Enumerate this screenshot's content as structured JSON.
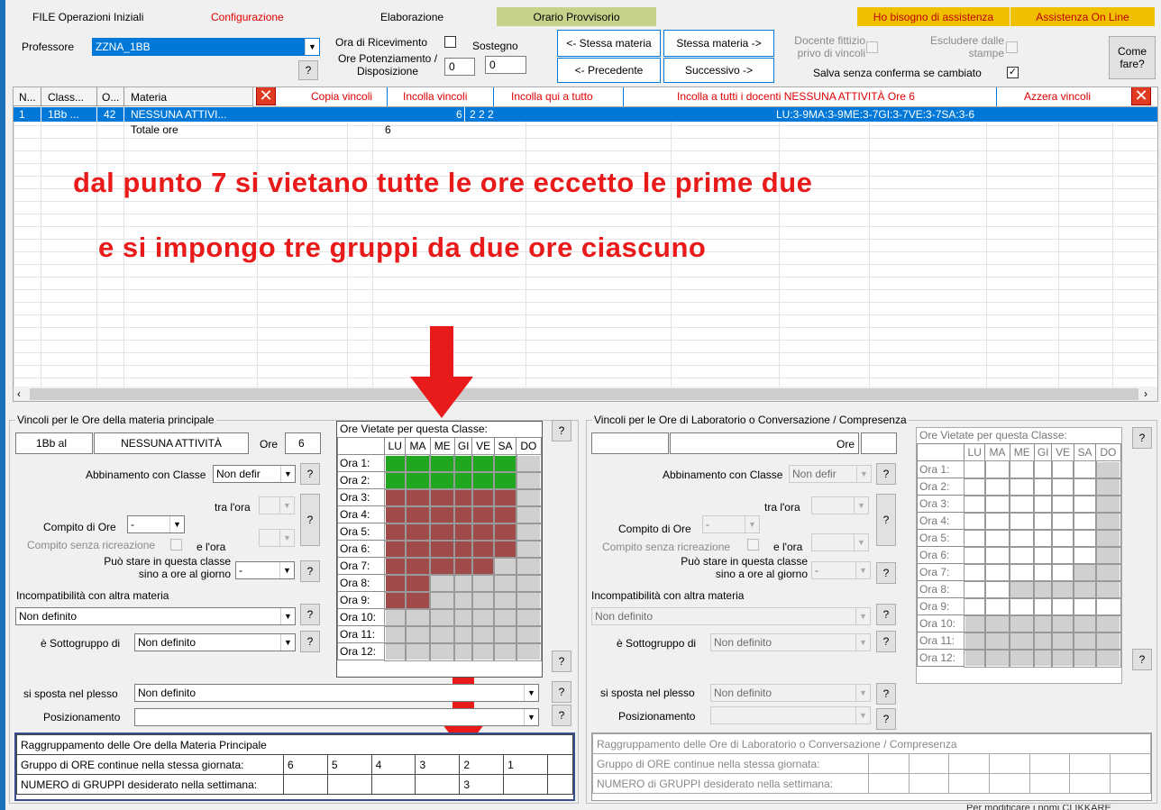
{
  "menu": {
    "file": "FILE Operazioni Iniziali",
    "config": "Configurazione",
    "elab": "Elaborazione",
    "orario": "Orario Provvisorio",
    "help": "Ho bisogno di assistenza",
    "online": "Assistenza On Line"
  },
  "top": {
    "prof_label": "Professore",
    "prof_value": "ZZNA_1BB",
    "ora_ric": "Ora di Ricevimento",
    "sostegno": "Sostegno",
    "ore_pot": "Ore Potenziamento / Disposizione",
    "pot_val": "0",
    "sost_val": "0",
    "q": "?",
    "stessa_prev": "<- Stessa materia",
    "stessa_next": "Stessa materia ->",
    "precedente": "<- Precedente",
    "successivo": "Successivo ->",
    "fittizio": "Docente fittizio privo di vincoli",
    "escludere": "Escludere dalle stampe",
    "salva": "Salva senza conferma se cambiato",
    "come": "Come fare?"
  },
  "grid": {
    "cols": [
      "N...",
      "Class...",
      "O...",
      "Materia"
    ],
    "actions": [
      "Copia vincoli",
      "Incolla vincoli",
      "Incolla qui a tutto",
      "Incolla a tutti i docenti NESSUNA ATTIVITÀ Ore 6",
      "Azzera vincoli"
    ],
    "row": {
      "n": "1",
      "classe": "1Bb ...",
      "o": "42",
      "materia": "NESSUNA ATTIVI...",
      "ore": "6",
      "gruppi": "2 2 2",
      "vincoli": "LU:3-9MA:3-9ME:3-7GI:3-7VE:3-7SA:3-6"
    },
    "total_label": "Totale ore",
    "total_val": "6"
  },
  "annotation": {
    "line1": "dal punto 7 si vietano tutte le ore eccetto le prime due",
    "line2": "e si impongo tre gruppi da due ore ciascuno"
  },
  "left": {
    "title": "Vincoli per le Ore della materia principale",
    "classe": "1Bb al",
    "materia": "NESSUNA ATTIVITÀ",
    "ore_label": "Ore",
    "ore_val": "6",
    "abbinamento": "Abbinamento con Classe",
    "abb_val": "Non defir",
    "tra_ora": "tra l'ora",
    "compito": "Compito di Ore",
    "compito_val": "-",
    "senza_ric": "Compito senza ricreazione",
    "e_ora": "e l'ora",
    "puo_stare": "Può stare in questa classe sino a ore al giorno",
    "puo_val": "-",
    "incomp": "Incompatibilità con altra materia",
    "incomp_val": "Non definito",
    "sottogruppo": "è Sottogruppo di",
    "sotto_val": "Non definito",
    "plesso": "si sposta nel plesso",
    "plesso_val": "Non definito",
    "posiz": "Posizionamento",
    "posiz_val": "",
    "ragg_title": "Raggruppamento delle Ore della Materia Principale",
    "gruppo_label": "Gruppo di ORE continue nella stessa giornata:",
    "gruppo_vals": [
      "6",
      "5",
      "4",
      "3",
      "2",
      "1",
      ""
    ],
    "numero_label": "NUMERO di GRUPPI desiderato nella settimana:",
    "numero_vals": [
      "",
      "",
      "",
      "",
      "3",
      "",
      ""
    ]
  },
  "right": {
    "title": "Vincoli per le Ore di Laboratorio o Conversazione / Compresenza",
    "ore_label": "Ore",
    "abbinamento": "Abbinamento con Classe",
    "abb_val": "Non defir",
    "tra_ora": "tra l'ora",
    "compito": "Compito di Ore",
    "compito_val": "-",
    "senza_ric": "Compito senza ricreazione",
    "e_ora": "e l'ora",
    "puo_stare": "Può stare in questa classe sino a ore al giorno",
    "puo_val": "-",
    "incomp": "Incompatibilità con altra materia",
    "incomp_val": "Non definito",
    "sottogruppo": "è Sottogruppo di",
    "sotto_val": "Non definito",
    "plesso": "si sposta nel plesso",
    "plesso_val": "Non definito",
    "posiz": "Posizionamento",
    "ragg_title": "Raggruppamento delle Ore di Laboratorio o Conversazione / Compresenza",
    "gruppo_label": "Gruppo di ORE continue nella stessa giornata:",
    "numero_label": "NUMERO di GRUPPI desiderato nella settimana:"
  },
  "ov": {
    "title": "Ore Vietate per questa Classe:",
    "days": [
      "LU",
      "MA",
      "ME",
      "GI",
      "VE",
      "SA",
      "DO"
    ],
    "rows": [
      "Ora 1:",
      "Ora 2:",
      "Ora 3:",
      "Ora 4:",
      "Ora 5:",
      "Ora 6:",
      "Ora 7:",
      "Ora 8:",
      "Ora 9:",
      "Ora 10:",
      "Ora 11:",
      "Ora 12:"
    ],
    "left_cells": [
      "GGGGGGX",
      "GGGGGGX",
      "RRRRRRX",
      "RRRRRRX",
      "RRRRRRX",
      "RRRRRRX",
      "RRRRRXX",
      "RRXXXXX",
      "RRXXXXX",
      "XXXXXXX",
      "XXXXXXX",
      "XXXXXXX"
    ],
    "right_cells": [
      "WWWWWWX",
      "WWWWWWX",
      "WWWWWWX",
      "WWWWWWX",
      "WWWWWWX",
      "WWWWWWX",
      "WWWWWXX",
      "WWXXXXX",
      "WWWWWWW",
      "XXXXXXX",
      "XXXXXXX",
      "XXXXXXX"
    ]
  },
  "footer": "Per modificare i nomi CLIKKARE"
}
